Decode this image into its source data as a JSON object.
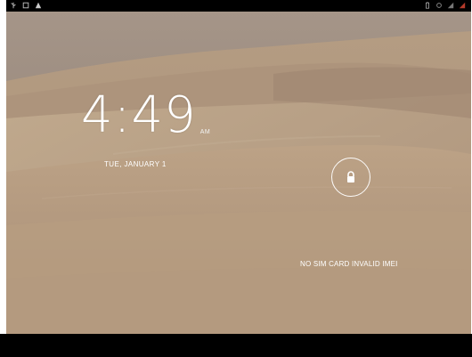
{
  "status_bar": {
    "left_icons": [
      "usb-icon",
      "screenshot-icon",
      "warning-icon"
    ],
    "right_icons": [
      "battery-icon",
      "sync-icon",
      "signal-icon",
      "alert-icon"
    ]
  },
  "lockscreen": {
    "time": "4:49",
    "ampm": "AM",
    "date": "TUE, JANUARY 1",
    "carrier_text": "NO SIM CARD   INVALID IMEI",
    "lock_icon": "lock-icon"
  },
  "colors": {
    "status_bar": "#000000",
    "sky": "#8f8278",
    "sand": "#b79e83",
    "sand_shadow": "#9e8672",
    "text": "#ffffff"
  }
}
